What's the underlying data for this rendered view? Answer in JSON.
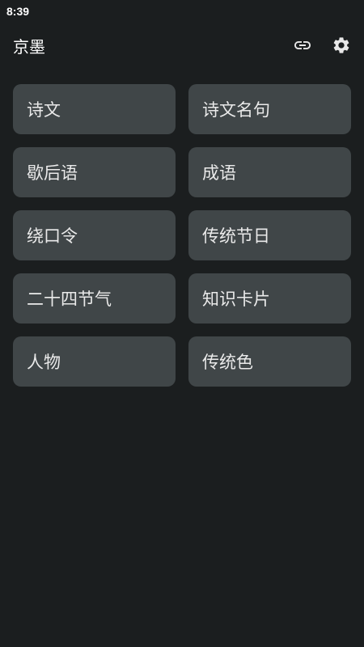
{
  "status_bar": {
    "time": "8:39"
  },
  "app_bar": {
    "title": "京墨",
    "icons": [
      "link-icon",
      "gear-icon"
    ]
  },
  "categories": [
    "诗文",
    "诗文名句",
    "歇后语",
    "成语",
    "绕口令",
    "传统节日",
    "二十四节气",
    "知识卡片",
    "人物",
    "传统色"
  ],
  "colors": {
    "background": "#1b1e1f",
    "card": "#404648",
    "text": "#eaeaea"
  }
}
